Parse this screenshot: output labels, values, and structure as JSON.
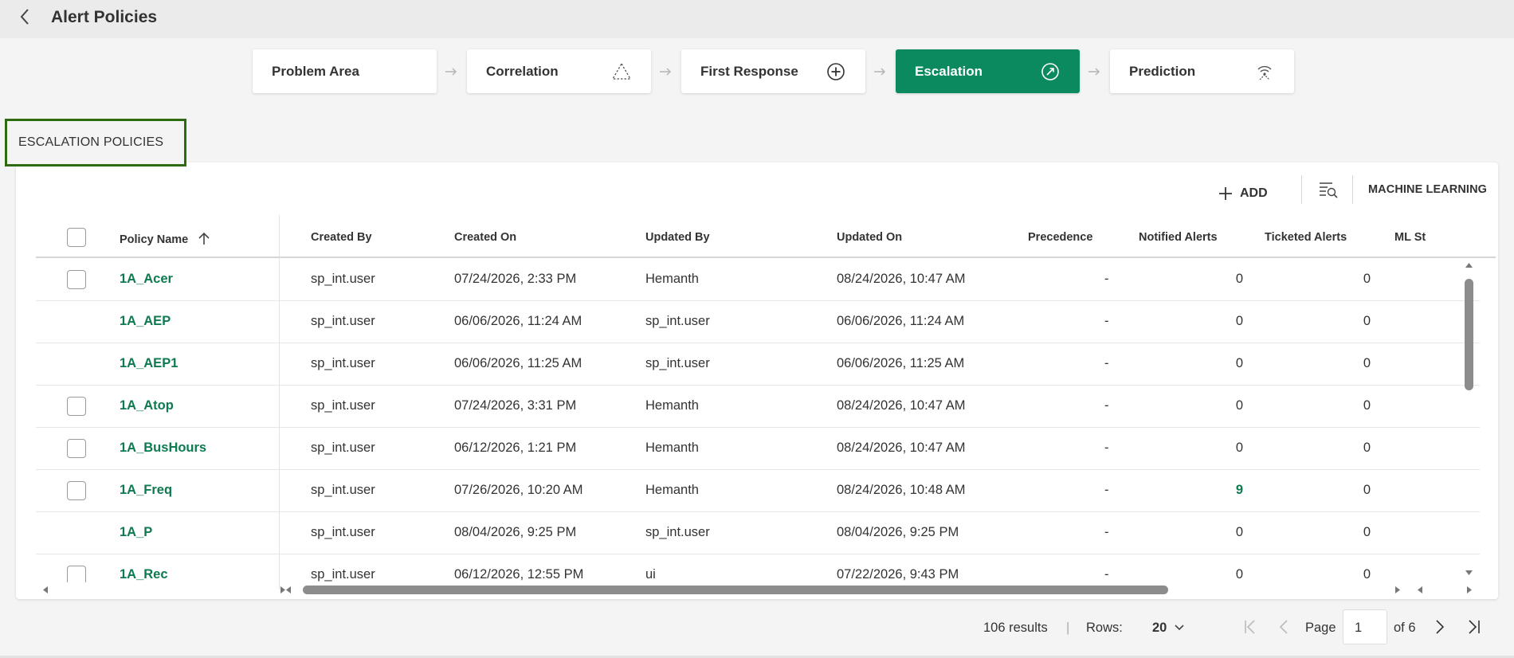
{
  "header": {
    "title": "Alert Policies"
  },
  "stepper": [
    {
      "label": "Problem Area",
      "icon": "none"
    },
    {
      "label": "Correlation",
      "icon": "triangle-dashed-icon"
    },
    {
      "label": "First Response",
      "icon": "plus-circle-icon"
    },
    {
      "label": "Escalation",
      "icon": "escalation-gauge-icon",
      "active": true
    },
    {
      "label": "Prediction",
      "icon": "prediction-signal-icon"
    }
  ],
  "section_label": "ESCALATION POLICIES",
  "toolbar": {
    "add_label": "ADD",
    "ml_label": "MACHINE LEARNING"
  },
  "table": {
    "headers": [
      "Policy Name",
      "Created By",
      "Created On",
      "Updated By",
      "Updated On",
      "Precedence",
      "Notified Alerts",
      "Ticketed Alerts",
      "ML St"
    ],
    "rows": [
      {
        "name": "1A_Acer",
        "created_by": "sp_int.user",
        "created_on": "07/24/2026, 2:33 PM",
        "updated_by": "Hemanth",
        "updated_on": "08/24/2026, 10:47 AM",
        "precedence": "-",
        "notified": "0",
        "ticketed": "0",
        "checkbox": true
      },
      {
        "name": "1A_AEP",
        "created_by": "sp_int.user",
        "created_on": "06/06/2026, 11:24 AM",
        "updated_by": "sp_int.user",
        "updated_on": "06/06/2026, 11:24 AM",
        "precedence": "-",
        "notified": "0",
        "ticketed": "0",
        "checkbox": false
      },
      {
        "name": "1A_AEP1",
        "created_by": "sp_int.user",
        "created_on": "06/06/2026, 11:25 AM",
        "updated_by": "sp_int.user",
        "updated_on": "06/06/2026, 11:25 AM",
        "precedence": "-",
        "notified": "0",
        "ticketed": "0",
        "checkbox": false
      },
      {
        "name": "1A_Atop",
        "created_by": "sp_int.user",
        "created_on": "07/24/2026, 3:31 PM",
        "updated_by": "Hemanth",
        "updated_on": "08/24/2026, 10:47 AM",
        "precedence": "-",
        "notified": "0",
        "ticketed": "0",
        "checkbox": true
      },
      {
        "name": "1A_BusHours",
        "created_by": "sp_int.user",
        "created_on": "06/12/2026, 1:21 PM",
        "updated_by": "Hemanth",
        "updated_on": "08/24/2026, 10:47 AM",
        "precedence": "-",
        "notified": "0",
        "ticketed": "0",
        "checkbox": true
      },
      {
        "name": "1A_Freq",
        "created_by": "sp_int.user",
        "created_on": "07/26/2026, 10:20 AM",
        "updated_by": "Hemanth",
        "updated_on": "08/24/2026, 10:48 AM",
        "precedence": "-",
        "notified": "9",
        "ticketed": "0",
        "checkbox": true,
        "notified_link": true
      },
      {
        "name": "1A_P",
        "created_by": "sp_int.user",
        "created_on": "08/04/2026, 9:25 PM",
        "updated_by": "sp_int.user",
        "updated_on": "08/04/2026, 9:25 PM",
        "precedence": "-",
        "notified": "0",
        "ticketed": "0",
        "checkbox": false
      },
      {
        "name": "1A_Rec",
        "created_by": "sp_int.user",
        "created_on": "06/12/2026, 12:55 PM",
        "updated_by": "ui",
        "updated_on": "07/22/2026, 9:43 PM",
        "precedence": "-",
        "notified": "0",
        "ticketed": "0",
        "checkbox": true
      }
    ]
  },
  "footer": {
    "results": "106 results",
    "separator": "|",
    "rows_label": "Rows:",
    "rows_value": "20",
    "page_label": "Page",
    "page_value": "1",
    "page_of": "of 6"
  },
  "colors": {
    "accent": "#0b8a5f",
    "link": "#0d7a4f",
    "highlight_border": "#2e6b10"
  }
}
